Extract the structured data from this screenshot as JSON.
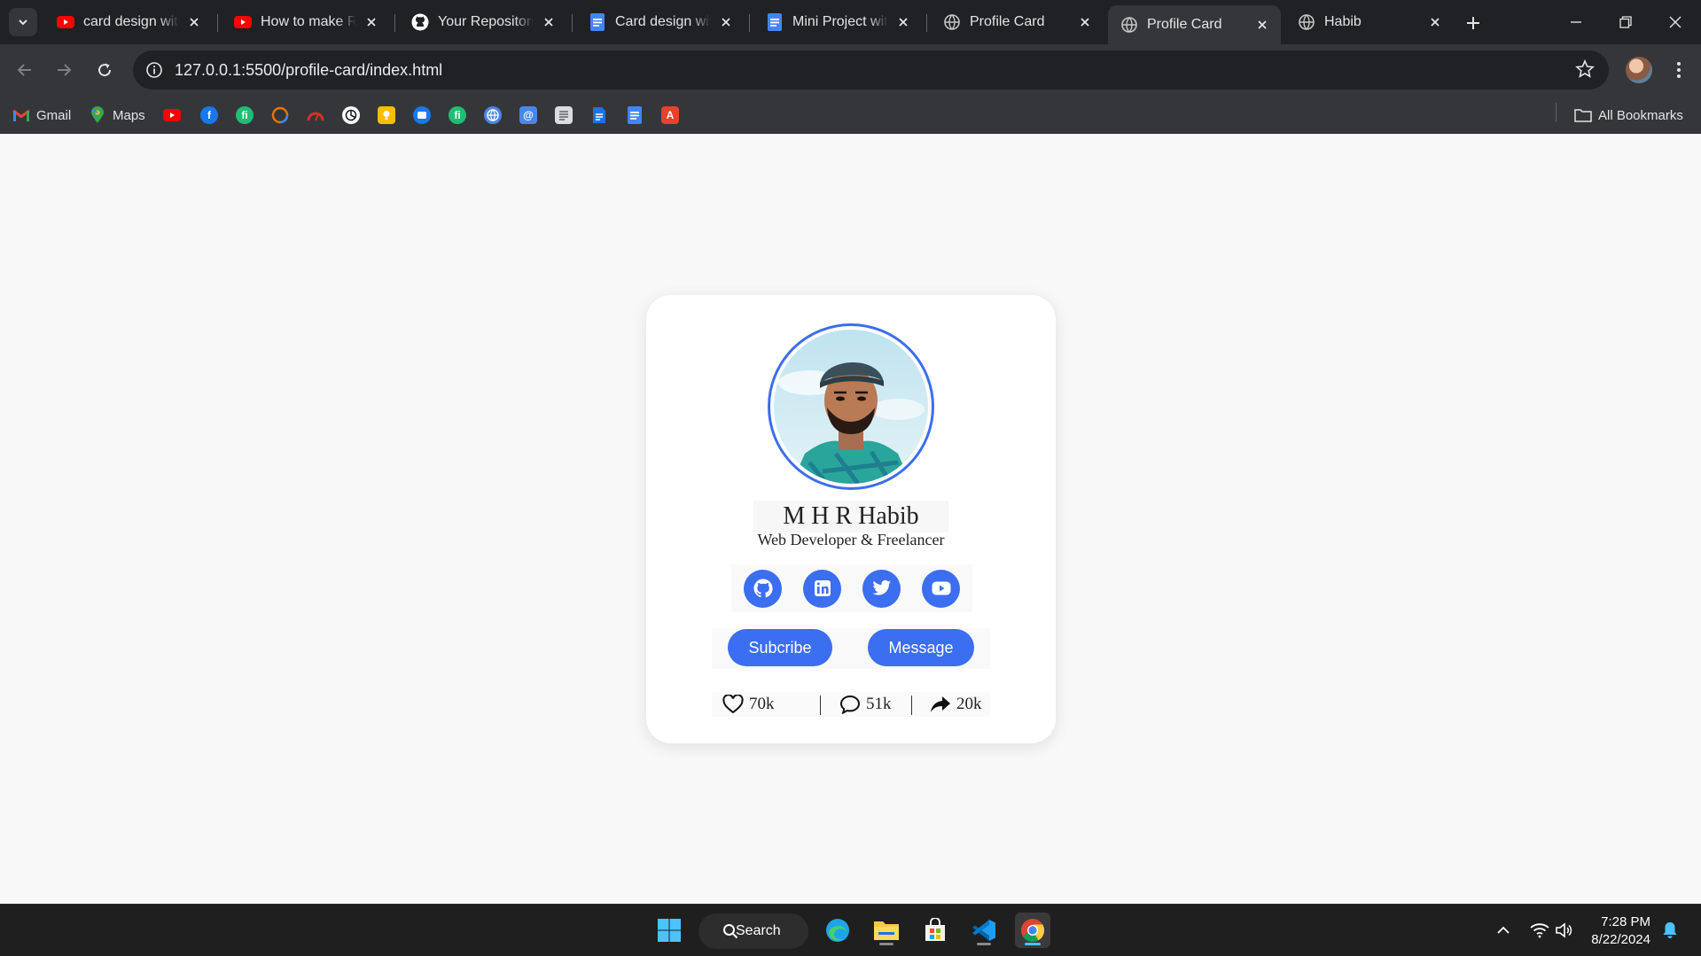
{
  "browser": {
    "tabs": [
      {
        "title": "card design with",
        "favicon": "youtube-icon",
        "active": false
      },
      {
        "title": "How to make Re",
        "favicon": "youtube-icon",
        "active": false
      },
      {
        "title": "Your Repositories",
        "favicon": "github-icon",
        "active": false
      },
      {
        "title": "Card design with",
        "favicon": "docs-icon",
        "active": false
      },
      {
        "title": "Mini Project with",
        "favicon": "docs-icon",
        "active": false
      },
      {
        "title": "Profile Card",
        "favicon": "globe-icon",
        "active": false
      },
      {
        "title": "Profile Card",
        "favicon": "globe-icon",
        "active": true
      },
      {
        "title": "Habib",
        "favicon": "globe-icon",
        "active": false
      }
    ],
    "url": "127.0.0.1:5500/profile-card/index.html",
    "bookmarks": [
      {
        "label": "Gmail",
        "icon": "gmail-icon"
      },
      {
        "label": "Maps",
        "icon": "maps-icon"
      },
      {
        "label": "",
        "icon": "youtube-icon"
      },
      {
        "label": "",
        "icon": "facebook-icon"
      },
      {
        "label": "",
        "icon": "fiverr-icon"
      },
      {
        "label": "",
        "icon": "circle-app-icon"
      },
      {
        "label": "",
        "icon": "speedometer-icon"
      },
      {
        "label": "",
        "icon": "chatgpt-icon"
      },
      {
        "label": "",
        "icon": "keep-icon"
      },
      {
        "label": "",
        "icon": "messenger-icon"
      },
      {
        "label": "",
        "icon": "fiverr-icon"
      },
      {
        "label": "",
        "icon": "web-icon"
      },
      {
        "label": "",
        "icon": "at-icon"
      },
      {
        "label": "",
        "icon": "notes-icon"
      },
      {
        "label": "",
        "icon": "file-icon"
      },
      {
        "label": "",
        "icon": "docs-icon"
      },
      {
        "label": "",
        "icon": "acrobat-icon"
      }
    ],
    "all_bookmarks_label": "All Bookmarks"
  },
  "profile": {
    "name": "M H R Habib",
    "role": "Web Developer & Freelancer",
    "socials": [
      "github-icon",
      "linkedin-icon",
      "twitter-icon",
      "youtube-icon"
    ],
    "buttons": {
      "subscribe": "Subcribe",
      "message": "Message"
    },
    "stats": {
      "likes": "70k",
      "comments": "51k",
      "shares": "20k"
    }
  },
  "colors": {
    "accent": "#3b6ef0",
    "card_bg": "#ffffff",
    "page_bg": "#f8f8f8",
    "chrome_dark": "#202124",
    "chrome_mid": "#35363a"
  },
  "taskbar": {
    "search_label": "Search",
    "time": "7:28 PM",
    "date": "8/22/2024"
  }
}
